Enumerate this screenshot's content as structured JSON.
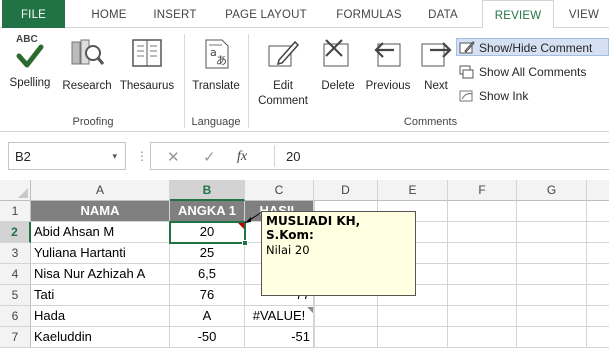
{
  "ribbon_tabs": [
    {
      "label": "FILE"
    },
    {
      "label": "HOME"
    },
    {
      "label": "INSERT"
    },
    {
      "label": "PAGE LAYOUT"
    },
    {
      "label": "FORMULAS"
    },
    {
      "label": "DATA"
    },
    {
      "label": "REVIEW"
    },
    {
      "label": "VIEW"
    }
  ],
  "active_tab": "REVIEW",
  "ribbon": {
    "proofing": {
      "label": "Proofing",
      "spelling": "Spelling",
      "spelling_icon_text": "ABC",
      "research": "Research",
      "thesaurus": "Thesaurus"
    },
    "language": {
      "label": "Language",
      "translate": "Translate"
    },
    "comments": {
      "label": "Comments",
      "edit_line1": "Edit",
      "edit_line2": "Comment",
      "delete": "Delete",
      "previous": "Previous",
      "next": "Next",
      "show_hide": "Show/Hide Comment",
      "show_all": "Show All Comments",
      "show_ink": "Show Ink"
    }
  },
  "formula_bar": {
    "name_box": "B2",
    "dropdown_glyph": "▾",
    "dots": "⋮",
    "cancel_glyph": "✕",
    "enter_glyph": "✓",
    "fx_label": "fx",
    "value": "20"
  },
  "columns": [
    "A",
    "B",
    "C",
    "D",
    "E",
    "F",
    "G"
  ],
  "rows": [
    "1",
    "2",
    "3",
    "4",
    "5",
    "6",
    "7"
  ],
  "table": {
    "headers": [
      "NAMA",
      "ANGKA 1",
      "HASIL"
    ],
    "data": [
      [
        "Abid Ahsan M",
        "20",
        ""
      ],
      [
        "Yuliana Hartanti",
        "25",
        ""
      ],
      [
        "Nisa Nur Azhizah A",
        "6,5",
        ""
      ],
      [
        "Tati",
        "76",
        "77"
      ],
      [
        "Hada",
        "A",
        "#VALUE!"
      ],
      [
        "Kaeluddin",
        "-50",
        "-51"
      ]
    ]
  },
  "comment": {
    "author": "MUSLIADI KH, S.Kom:",
    "text": "Nilai 20"
  },
  "colors": {
    "accent": "#217346",
    "header_fill": "#808080",
    "comment_bg": "#ffffe1",
    "comment_indicator": "#c00000"
  }
}
